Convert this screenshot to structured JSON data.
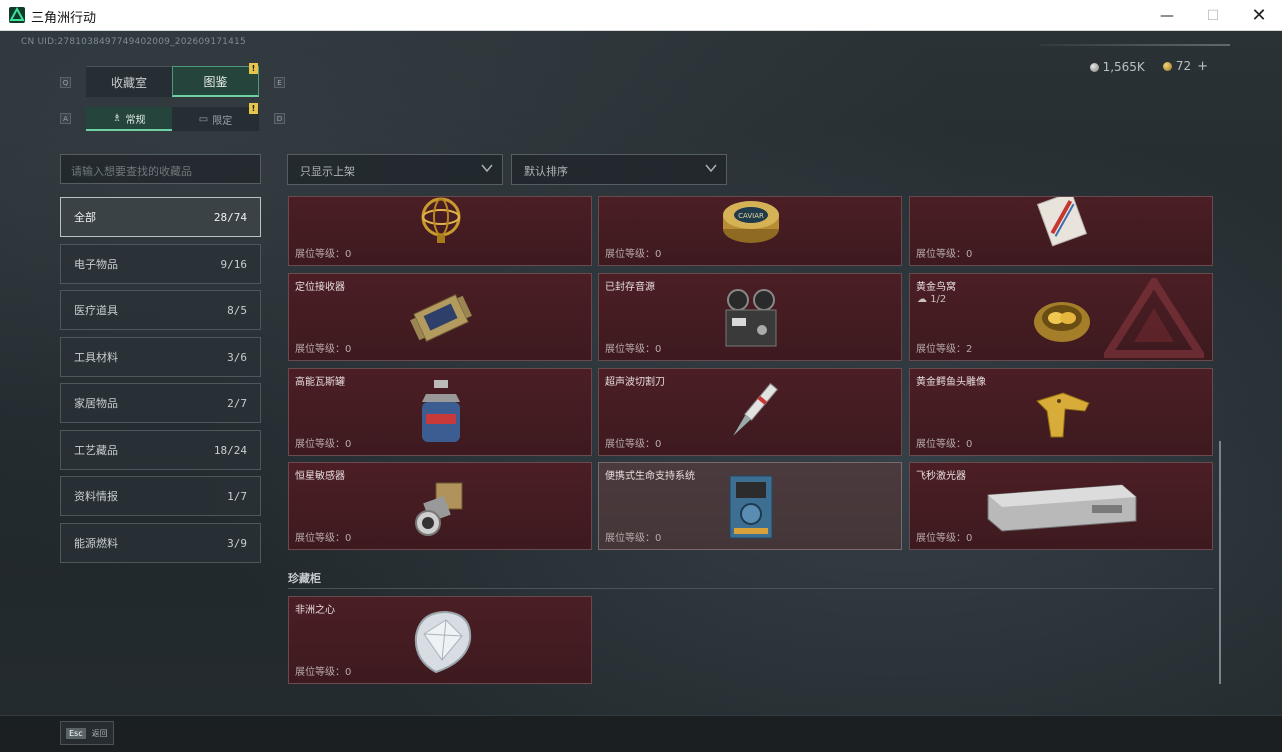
{
  "window": {
    "title": "三角洲行动",
    "min": "—",
    "max": "☐",
    "close": "✕"
  },
  "uid": "CN UID:2781038497749402009_202609171415",
  "currency": {
    "silver": "1,565K",
    "gold": "72",
    "plus": "+"
  },
  "keys": {
    "q": "Q",
    "e": "E",
    "a": "A",
    "d": "D"
  },
  "tabs": [
    {
      "label": "收藏室"
    },
    {
      "label": "图鉴"
    }
  ],
  "subtabs": [
    {
      "label": "常规"
    },
    {
      "label": "限定"
    }
  ],
  "badge": "!",
  "search": {
    "placeholder": "请输入想要查找的收藏品"
  },
  "filters": {
    "shelf": "只显示上架",
    "sort": "默认排序"
  },
  "categories": [
    {
      "label": "全部",
      "count": "28/74"
    },
    {
      "label": "电子物品",
      "count": "9/16"
    },
    {
      "label": "医疗道具",
      "count": "8/5"
    },
    {
      "label": "工具材料",
      "count": "3/6"
    },
    {
      "label": "家居物品",
      "count": "2/7"
    },
    {
      "label": "工艺藏品",
      "count": "18/24"
    },
    {
      "label": "资料情报",
      "count": "1/7"
    },
    {
      "label": "能源燃料",
      "count": "3/9"
    }
  ],
  "level_prefix": "展位等级：",
  "items": [
    {
      "name": "",
      "level": "0",
      "icon": "armillary-sphere-icon"
    },
    {
      "name": "",
      "level": "0",
      "icon": "caviar-tin-icon"
    },
    {
      "name": "",
      "level": "0",
      "icon": "card-icon"
    },
    {
      "name": "定位接收器",
      "level": "0",
      "icon": "locator-receiver-icon"
    },
    {
      "name": "已封存音源",
      "level": "0",
      "icon": "tape-recorder-icon"
    },
    {
      "name": "黄金鸟窝",
      "sub": "1/2",
      "level": "2",
      "icon": "golden-nest-icon"
    },
    {
      "name": "高能瓦斯罐",
      "level": "0",
      "icon": "gas-canister-icon"
    },
    {
      "name": "超声波切割刀",
      "level": "0",
      "icon": "ultrasonic-knife-icon"
    },
    {
      "name": "黄金鳄鱼头雕像",
      "level": "0",
      "icon": "gold-crocodile-head-icon"
    },
    {
      "name": "恒星敏感器",
      "level": "0",
      "icon": "star-sensor-icon"
    },
    {
      "name": "便携式生命支持系统",
      "level": "0",
      "icon": "life-support-icon"
    },
    {
      "name": "飞秒激光器",
      "level": "0",
      "icon": "femtosecond-laser-icon"
    }
  ],
  "vault": {
    "title": "珍藏柜",
    "items": [
      {
        "name": "非洲之心",
        "level": "0",
        "icon": "diamond-icon"
      }
    ]
  },
  "footer": {
    "key": "Esc",
    "label": "返回"
  }
}
